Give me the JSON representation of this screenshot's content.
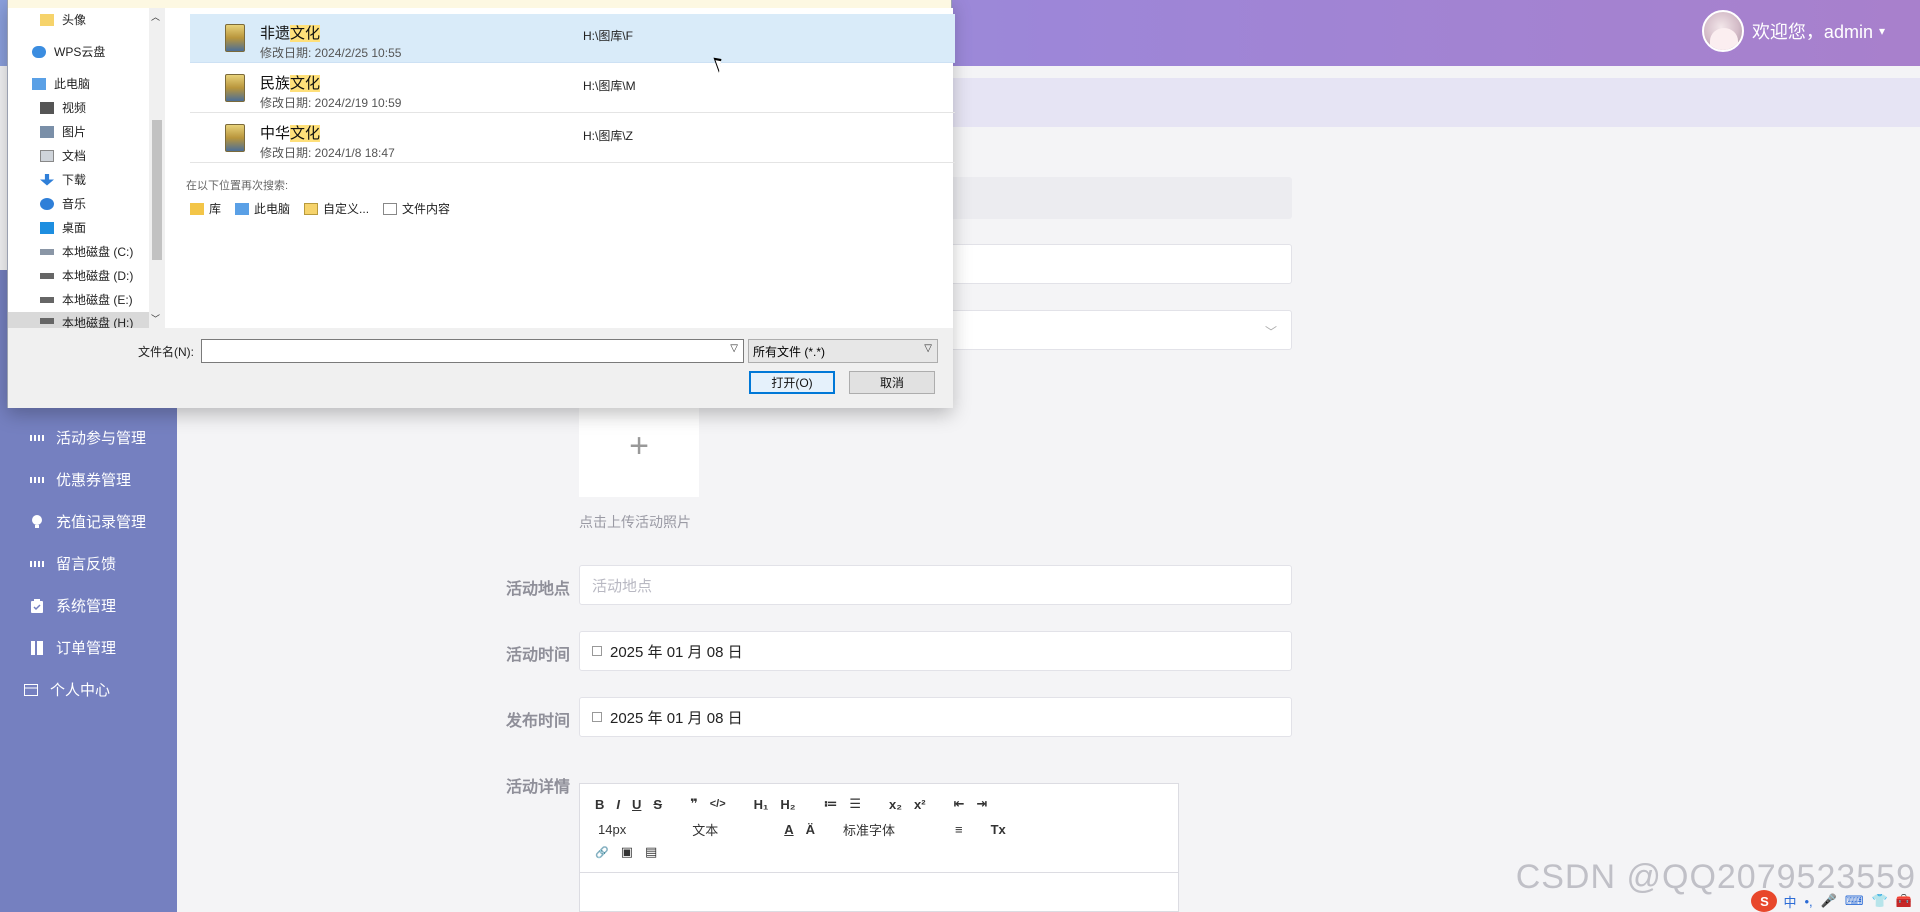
{
  "header": {
    "welcome_text": "欢迎您，admin",
    "caret": "▾"
  },
  "sidebar": {
    "items": [
      {
        "label": "活动参与管理"
      },
      {
        "label": "优惠券管理"
      },
      {
        "label": "充值记录管理"
      },
      {
        "label": "留言反馈"
      },
      {
        "label": "系统管理"
      },
      {
        "label": "订单管理"
      },
      {
        "label": "个人中心"
      }
    ]
  },
  "form": {
    "upload_tip": "点击上传活动照片",
    "upload_plus": "+",
    "location_label": "活动地点",
    "location_placeholder": "活动地点",
    "activity_time_label": "活动时间",
    "activity_time_value": "2025 年 01 月 08 日",
    "publish_time_label": "发布时间",
    "publish_time_value": "2025 年 01 月 08 日",
    "details_label": "活动详情"
  },
  "editor": {
    "row1": [
      "B",
      "I",
      "U",
      "S",
      "❞",
      "</>",
      "H₁",
      "H₂",
      "≔",
      "☰",
      "x₂",
      "x²",
      "⇤",
      "⇥"
    ],
    "font_size": "14px",
    "text_style": "文本",
    "font_family": "标准字体",
    "row2_icons": [
      "A",
      "Ä",
      "≡",
      "Tx"
    ],
    "row3": [
      "🔗",
      "▣",
      "▤"
    ]
  },
  "dialog": {
    "nav": [
      {
        "label": "头像"
      },
      {
        "label": "WPS云盘"
      },
      {
        "label": "此电脑"
      },
      {
        "label": "视频"
      },
      {
        "label": "图片"
      },
      {
        "label": "文档"
      },
      {
        "label": "下载"
      },
      {
        "label": "音乐"
      },
      {
        "label": "桌面"
      },
      {
        "label": "本地磁盘 (C:)"
      },
      {
        "label": "本地磁盘 (D:)"
      },
      {
        "label": "本地磁盘 (E:)"
      },
      {
        "label": "本地磁盘 (H:)"
      }
    ],
    "results": [
      {
        "name_prefix": "非遗",
        "name_hl": "文化",
        "date": "修改日期: 2024/2/25 10:55",
        "path": "H:\\图库\\F"
      },
      {
        "name_prefix": "民族",
        "name_hl": "文化",
        "date": "修改日期: 2024/2/19 10:59",
        "path": "H:\\图库\\M"
      },
      {
        "name_prefix": "中华",
        "name_hl": "文化",
        "date": "修改日期: 2024/1/8 18:47",
        "path": "H:\\图库\\Z"
      }
    ],
    "search_again": "在以下位置再次搜索:",
    "search_locations": [
      "库",
      "此电脑",
      "自定义...",
      "文件内容"
    ],
    "filename_label": "文件名(N):",
    "filename_value": "",
    "filetype": "所有文件 (*.*)",
    "open_button": "打开(O)",
    "cancel_button": "取消"
  },
  "watermark": "CSDN @QQ2079523559",
  "tray": {
    "ime": "中",
    "sogou": "S"
  },
  "colors": {
    "sidebar": "#7580c0",
    "topbar_start": "#8ba0dd",
    "topbar_end": "#a880cc",
    "highlight": "#ffe07a",
    "selected_row": "#d9ebf9"
  }
}
